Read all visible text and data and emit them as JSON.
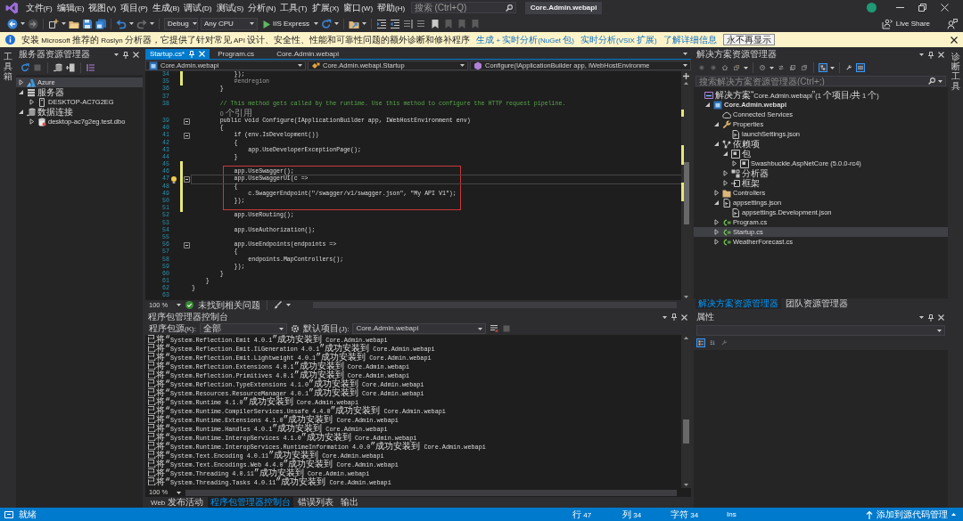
{
  "title_bar": {
    "menu": [
      "文件(F)",
      "编辑(E)",
      "视图(V)",
      "项目(P)",
      "生成(B)",
      "调试(D)",
      "测试(S)",
      "分析(N)",
      "工具(T)",
      "扩展(X)",
      "窗口(W)",
      "帮助(H)"
    ],
    "search": {
      "placeholder": "搜索 (Ctrl+Q)"
    },
    "solution_title": "Core.Admin.webapi"
  },
  "toolbar": {
    "configuration": "Debug",
    "platform": "Any CPU",
    "run_target": "IIS Express",
    "live_share": "Live Share"
  },
  "info_bar": {
    "message": "安装 Microsoft 推荐的 Roslyn 分析器，它提供了针对常见 API 设计、安全性、性能和可靠性问题的额外诊断和修补程序",
    "links": [
      "生成 + 实时分析(NuGet 包)",
      "实时分析(VSIX 扩展)",
      "了解详细信息"
    ],
    "button": "永不再显示"
  },
  "left_strip": {
    "label": "工具箱"
  },
  "server_explorer": {
    "title": "服务器资源管理器",
    "tree": [
      {
        "label": "Azure",
        "kind": "cloud",
        "expanded": false,
        "selected": true
      },
      {
        "label": "服务器",
        "kind": "servers",
        "expanded": true,
        "selected": false,
        "children": [
          {
            "label": "DESKTOP-AC7G2EG",
            "kind": "computer",
            "expanded": false,
            "selected": false
          }
        ]
      },
      {
        "label": "数据连接",
        "kind": "connections",
        "expanded": true,
        "selected": false,
        "children": [
          {
            "label": "desktop-ac7g2eg.test.dbo",
            "kind": "database",
            "expanded": false,
            "selected": false
          }
        ]
      }
    ]
  },
  "editor": {
    "tabs": [
      {
        "label": "Startup.cs*",
        "selected": true
      },
      {
        "label": "Program.cs",
        "selected": false
      },
      {
        "label": "Core.Admin.webapi",
        "selected": false
      }
    ],
    "navigation": [
      "Core.Admin.webapi",
      "Core.Admin.webapi.Startup",
      "Configure(IApplicationBuilder app, IWebHostEnvironme"
    ],
    "lines": [
      {
        "number": "34",
        "text": "            });",
        "kind": "code",
        "changed": true,
        "foldable": false,
        "lightbulb": false,
        "current": false,
        "highlighted": false
      },
      {
        "number": "35",
        "text": "            #endregion",
        "kind": "directive",
        "changed": true,
        "foldable": false,
        "lightbulb": false,
        "current": false,
        "highlighted": false
      },
      {
        "number": "36",
        "text": "        }",
        "kind": "code",
        "changed": false,
        "foldable": false,
        "lightbulb": false,
        "current": false,
        "highlighted": false
      },
      {
        "number": "37",
        "kind": "code",
        "changed": false,
        "foldable": false,
        "lightbulb": false,
        "current": false,
        "highlighted": false
      },
      {
        "number": "38",
        "text": "        // This method gets called by the runtime. Use this method to configure the HTTP request pipeline.",
        "kind": "comment",
        "changed": false,
        "foldable": false,
        "lightbulb": false,
        "current": false,
        "highlighted": false
      },
      {
        "text": "        0 个引用",
        "kind": "lens",
        "changed": false,
        "foldable": false,
        "lightbulb": false,
        "current": false,
        "highlighted": false
      },
      {
        "number": "39",
        "text": "        public void Configure(IApplicationBuilder app, IWebHostEnvironment env)",
        "kind": "code",
        "changed": false,
        "foldable": true,
        "lightbulb": false,
        "current": false,
        "highlighted": false
      },
      {
        "number": "40",
        "text": "        {",
        "kind": "code",
        "changed": false,
        "foldable": false,
        "lightbulb": false,
        "current": false,
        "highlighted": false
      },
      {
        "number": "41",
        "text": "            if (env.IsDevelopment())",
        "kind": "code",
        "changed": false,
        "foldable": true,
        "lightbulb": false,
        "current": false,
        "highlighted": false
      },
      {
        "number": "42",
        "text": "            {",
        "kind": "code",
        "changed": false,
        "foldable": false,
        "lightbulb": false,
        "current": false,
        "highlighted": false
      },
      {
        "number": "43",
        "text": "                app.UseDeveloperExceptionPage();",
        "kind": "code",
        "changed": false,
        "foldable": false,
        "lightbulb": false,
        "current": false,
        "highlighted": false
      },
      {
        "number": "44",
        "text": "            }",
        "kind": "code",
        "changed": false,
        "foldable": false,
        "lightbulb": false,
        "current": false,
        "highlighted": false
      },
      {
        "number": "45",
        "kind": "code",
        "changed": true,
        "foldable": false,
        "lightbulb": false,
        "current": false,
        "highlighted": false
      },
      {
        "number": "46",
        "text": "            app.UseSwagger();",
        "kind": "code",
        "changed": true,
        "foldable": false,
        "lightbulb": false,
        "current": false,
        "highlighted": true
      },
      {
        "number": "47",
        "text": "            app.UseSwaggerUI(c =>",
        "kind": "code",
        "changed": true,
        "foldable": true,
        "lightbulb": true,
        "current": true,
        "highlighted": true
      },
      {
        "number": "48",
        "text": "            {",
        "kind": "code",
        "changed": true,
        "foldable": false,
        "lightbulb": false,
        "current": false,
        "highlighted": true
      },
      {
        "number": "49",
        "text": "                c.SwaggerEndpoint(\"/swagger/v1/swagger.json\", \"My API V1\");",
        "kind": "code",
        "changed": true,
        "foldable": false,
        "lightbulb": false,
        "current": false,
        "highlighted": true
      },
      {
        "number": "50",
        "text": "            });",
        "kind": "code",
        "changed": true,
        "foldable": false,
        "lightbulb": false,
        "current": false,
        "highlighted": true
      },
      {
        "number": "51",
        "kind": "code",
        "changed": true,
        "foldable": false,
        "lightbulb": false,
        "current": false,
        "highlighted": false
      },
      {
        "number": "52",
        "text": "            app.UseRouting();",
        "kind": "code",
        "changed": false,
        "foldable": false,
        "lightbulb": false,
        "current": false,
        "highlighted": false
      },
      {
        "number": "53",
        "kind": "code",
        "changed": false,
        "foldable": false,
        "lightbulb": false,
        "current": false,
        "highlighted": false
      },
      {
        "number": "54",
        "text": "            app.UseAuthorization();",
        "kind": "code",
        "changed": false,
        "foldable": false,
        "lightbulb": false,
        "current": false,
        "highlighted": false
      },
      {
        "number": "55",
        "kind": "code",
        "changed": false,
        "foldable": false,
        "lightbulb": false,
        "current": false,
        "highlighted": false
      },
      {
        "number": "56",
        "text": "            app.UseEndpoints(endpoints =>",
        "kind": "code",
        "changed": false,
        "foldable": true,
        "lightbulb": false,
        "current": false,
        "highlighted": false
      },
      {
        "number": "57",
        "text": "            {",
        "kind": "code",
        "changed": false,
        "foldable": false,
        "lightbulb": false,
        "current": false,
        "highlighted": false
      },
      {
        "number": "58",
        "text": "                endpoints.MapControllers();",
        "kind": "code",
        "changed": false,
        "foldable": false,
        "lightbulb": false,
        "current": false,
        "highlighted": false
      },
      {
        "number": "59",
        "text": "            });",
        "kind": "code",
        "changed": false,
        "foldable": false,
        "lightbulb": false,
        "current": false,
        "highlighted": false
      },
      {
        "number": "60",
        "text": "        }",
        "kind": "code",
        "changed": false,
        "foldable": false,
        "lightbulb": false,
        "current": false,
        "highlighted": false
      },
      {
        "number": "61",
        "text": "    }",
        "kind": "code",
        "changed": false,
        "foldable": false,
        "lightbulb": false,
        "current": false,
        "highlighted": false
      },
      {
        "number": "62",
        "text": "}",
        "kind": "code",
        "changed": false,
        "foldable": false,
        "lightbulb": false,
        "current": false,
        "highlighted": false
      },
      {
        "number": "63",
        "kind": "code",
        "changed": false,
        "foldable": false,
        "lightbulb": false,
        "current": false,
        "highlighted": false
      }
    ],
    "zoom": "100 %",
    "issues": "未找到相关问题"
  },
  "console": {
    "title": "程序包管理器控制台",
    "source_label": "程序包源(K):",
    "source": "全部",
    "project_label": "默认项目(J):",
    "project": "Core.Admin.webapi",
    "lines": [
      "已将“System.Reflection.Emit 4.0.1”成功安装到 Core.Admin.webapi",
      "已将“System.Reflection.Emit.ILGeneration 4.0.1”成功安装到 Core.Admin.webapi",
      "已将“System.Reflection.Emit.Lightweight 4.0.1”成功安装到 Core.Admin.webapi",
      "已将“System.Reflection.Extensions 4.0.1”成功安装到 Core.Admin.webapi",
      "已将“System.Reflection.Primitives 4.0.1”成功安装到 Core.Admin.webapi",
      "已将“System.Reflection.TypeExtensions 4.1.0”成功安装到 Core.Admin.webapi",
      "已将“System.Resources.ResourceManager 4.0.1”成功安装到 Core.Admin.webapi",
      "已将“System.Runtime 4.1.0”成功安装到 Core.Admin.webapi",
      "已将“System.Runtime.CompilerServices.Unsafe 4.4.0”成功安装到 Core.Admin.webapi",
      "已将“System.Runtime.Extensions 4.1.0”成功安装到 Core.Admin.webapi",
      "已将“System.Runtime.Handles 4.0.1”成功安装到 Core.Admin.webapi",
      "已将“System.Runtime.InteropServices 4.1.0”成功安装到 Core.Admin.webapi",
      "已将“System.Runtime.InteropServices.RuntimeInformation 4.0.0”成功安装到 Core.Admin.webapi",
      "已将“System.Text.Encoding 4.0.11”成功安装到 Core.Admin.webapi",
      "已将“System.Text.Encodings.Web 4.4.0”成功安装到 Core.Admin.webapi",
      "已将“System.Threading 4.0.11”成功安装到 Core.Admin.webapi",
      "已将“System.Threading.Tasks 4.0.11”成功安装到 Core.Admin.webapi"
    ],
    "zoom": "100 %",
    "tabs": [
      {
        "label": "Web 发布活动",
        "selected": false
      },
      {
        "label": "程序包管理器控制台",
        "selected": true
      },
      {
        "label": "错误列表",
        "selected": false
      },
      {
        "label": "输出",
        "selected": false
      }
    ]
  },
  "solution_explorer": {
    "title": "解决方案资源管理器",
    "toolbar": [
      {
        "pressed": false
      },
      {
        "pressed": false
      },
      {
        "pressed": false
      },
      {
        "pressed": false
      },
      {
        "pressed": false
      },
      {
        "pressed": false
      },
      {
        "pressed": false
      },
      {
        "pressed": false
      },
      {
        "pressed": true
      },
      {
        "pressed": false
      },
      {
        "pressed": true
      }
    ],
    "search": {
      "placeholder": "搜索解决方案资源管理器(Ctrl+;)"
    },
    "tree": [
      {
        "label": "解决方案“Core.Admin.webapi”(1 个项目/共 1 个)",
        "kind": "solution",
        "selected": false,
        "children": [
          {
            "label": "Core.Admin.webapi",
            "kind": "project",
            "expanded": true,
            "selected": false,
            "children": [
              {
                "label": "Connected Services",
                "kind": "connected",
                "selected": false
              },
              {
                "label": "Properties",
                "kind": "properties",
                "expanded": true,
                "selected": false,
                "children": [
                  {
                    "label": "launchSettings.json",
                    "kind": "json",
                    "selected": false
                  }
                ]
              },
              {
                "label": "依赖项",
                "kind": "dependencies",
                "expanded": true,
                "selected": false,
                "children": [
                  {
                    "label": "包",
                    "kind": "packages",
                    "expanded": true,
                    "selected": false,
                    "children": [
                      {
                        "label": "Swashbuckle.AspNetCore (5.0.0-rc4)",
                        "kind": "package",
                        "expanded": false,
                        "selected": false
                      }
                    ]
                  },
                  {
                    "label": "分析器",
                    "kind": "analyzers",
                    "expanded": false,
                    "selected": false
                  },
                  {
                    "label": "框架",
                    "kind": "frameworks",
                    "expanded": false,
                    "selected": false
                  }
                ]
              },
              {
                "label": "Controllers",
                "kind": "folder",
                "expanded": false,
                "selected": false
              },
              {
                "label": "appsettings.json",
                "kind": "json",
                "expanded": true,
                "selected": false,
                "children": [
                  {
                    "label": "appsettings.Development.json",
                    "kind": "json",
                    "selected": false
                  }
                ]
              },
              {
                "label": "Program.cs",
                "kind": "csharp",
                "expanded": false,
                "selected": false
              },
              {
                "label": "Startup.cs",
                "kind": "csharp",
                "expanded": false,
                "selected": true
              },
              {
                "label": "WeatherForecast.cs",
                "kind": "csharp",
                "expanded": false,
                "selected": false
              }
            ]
          }
        ]
      }
    ],
    "tabs": [
      {
        "label": "解决方案资源管理器",
        "selected": true
      },
      {
        "label": "团队资源管理器",
        "selected": false
      }
    ]
  },
  "properties": {
    "title": "属性",
    "toolbar": [
      {
        "pressed": true
      },
      {
        "pressed": false
      },
      {
        "pressed": false
      }
    ]
  },
  "right_strip": {
    "label": "诊断工具"
  },
  "status_bar": {
    "status": "就绪",
    "line": "行 47",
    "column": "列 34",
    "character": "字符 34",
    "mode": "Ins",
    "source_control": "添加到源代码管理"
  }
}
